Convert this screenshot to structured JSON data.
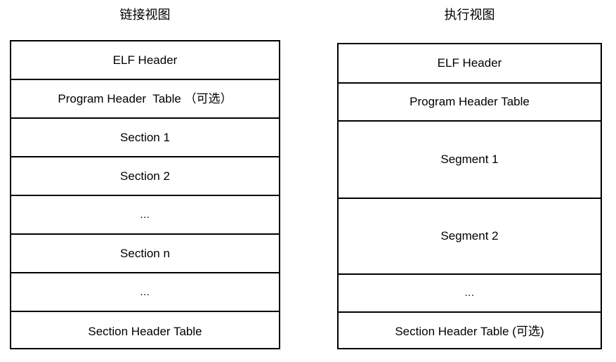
{
  "diagram": {
    "title": "ELF file linking view and execution view",
    "background_color": "#ffffff",
    "border_color": "#000000",
    "text_color": "#000000"
  },
  "link_view": {
    "title": "链接视图",
    "rows": [
      {
        "label": "ELF Header",
        "kind": "header"
      },
      {
        "label": "Program Header  Table （可选）",
        "kind": "header"
      },
      {
        "label": "Section 1",
        "kind": "section"
      },
      {
        "label": "Section 2",
        "kind": "section"
      },
      {
        "label": "...",
        "kind": "ellipsis"
      },
      {
        "label": "Section n",
        "kind": "section"
      },
      {
        "label": "...",
        "kind": "ellipsis"
      },
      {
        "label": "Section Header Table",
        "kind": "header"
      }
    ]
  },
  "exec_view": {
    "title": "执行视图",
    "rows": [
      {
        "label": "ELF Header",
        "kind": "header"
      },
      {
        "label": "Program Header Table",
        "kind": "header"
      },
      {
        "label": "Segment 1",
        "kind": "segment"
      },
      {
        "label": "Segment 2",
        "kind": "segment"
      },
      {
        "label": "...",
        "kind": "ellipsis"
      },
      {
        "label": "Section Header Table (可选)",
        "kind": "header"
      }
    ]
  }
}
